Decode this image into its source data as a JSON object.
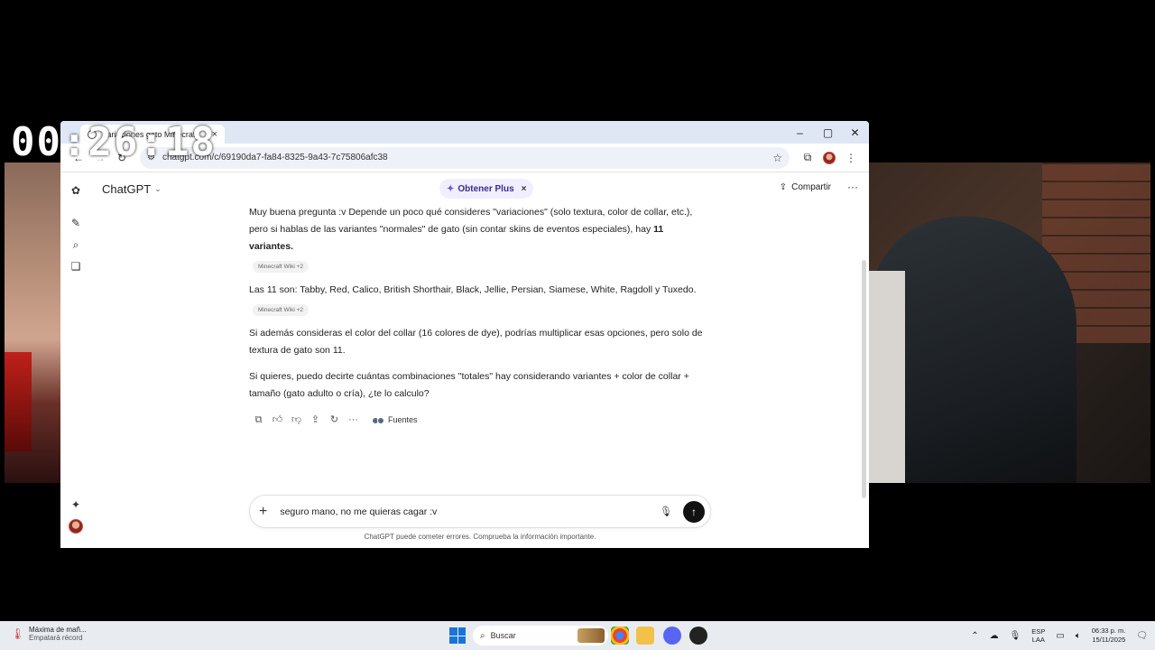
{
  "overlay": {
    "timer": "00:26:18"
  },
  "browser": {
    "tab_title": "Variaciones gato Minecraft",
    "url": "chatgpt.com/c/69190da7-fa84-8325-9a43-7c75806afc38"
  },
  "app": {
    "model_label": "ChatGPT",
    "upgrade_label": "Obtener Plus",
    "share_label": "Compartir"
  },
  "conversation": {
    "p1_text": "Muy buena pregunta :v Depende un poco qué consideres \"variaciones\" (solo textura, color de collar, etc.), pero si hablas de las variantes \"normales\" de gato (sin contar skins de eventos especiales), hay ",
    "p1_bold": "11 variantes",
    "p1_end": ".",
    "cite1": "Minecraft Wiki +2",
    "p2": "Las 11 son: Tabby, Red, Calico, British Shorthair, Black, Jellie, Persian, Siamese, White, Ragdoll y Tuxedo.",
    "cite2": "Minecraft Wiki +2",
    "p3": "Si además consideras el color del collar (16 colores de dye), podrías multiplicar esas opciones, pero solo de textura de gato son 11.",
    "p4": "Si quieres, puedo decirte cuántas combinaciones \"totales\" hay considerando variantes + color de collar + tamaño (gato adulto o cría), ¿te lo calculo?",
    "sources_label": "Fuentes"
  },
  "composer": {
    "value": "seguro mano, no me quieras cagar :v",
    "disclaimer": "ChatGPT puede cometer errores. Comprueba la información importante."
  },
  "taskbar": {
    "weather_title": "Máxima de mañ...",
    "weather_sub": "Empatará récord",
    "search_placeholder": "Buscar",
    "lang_top": "ESP",
    "lang_bottom": "LAA",
    "time": "06:33 p. m.",
    "date": "15/11/2025"
  }
}
